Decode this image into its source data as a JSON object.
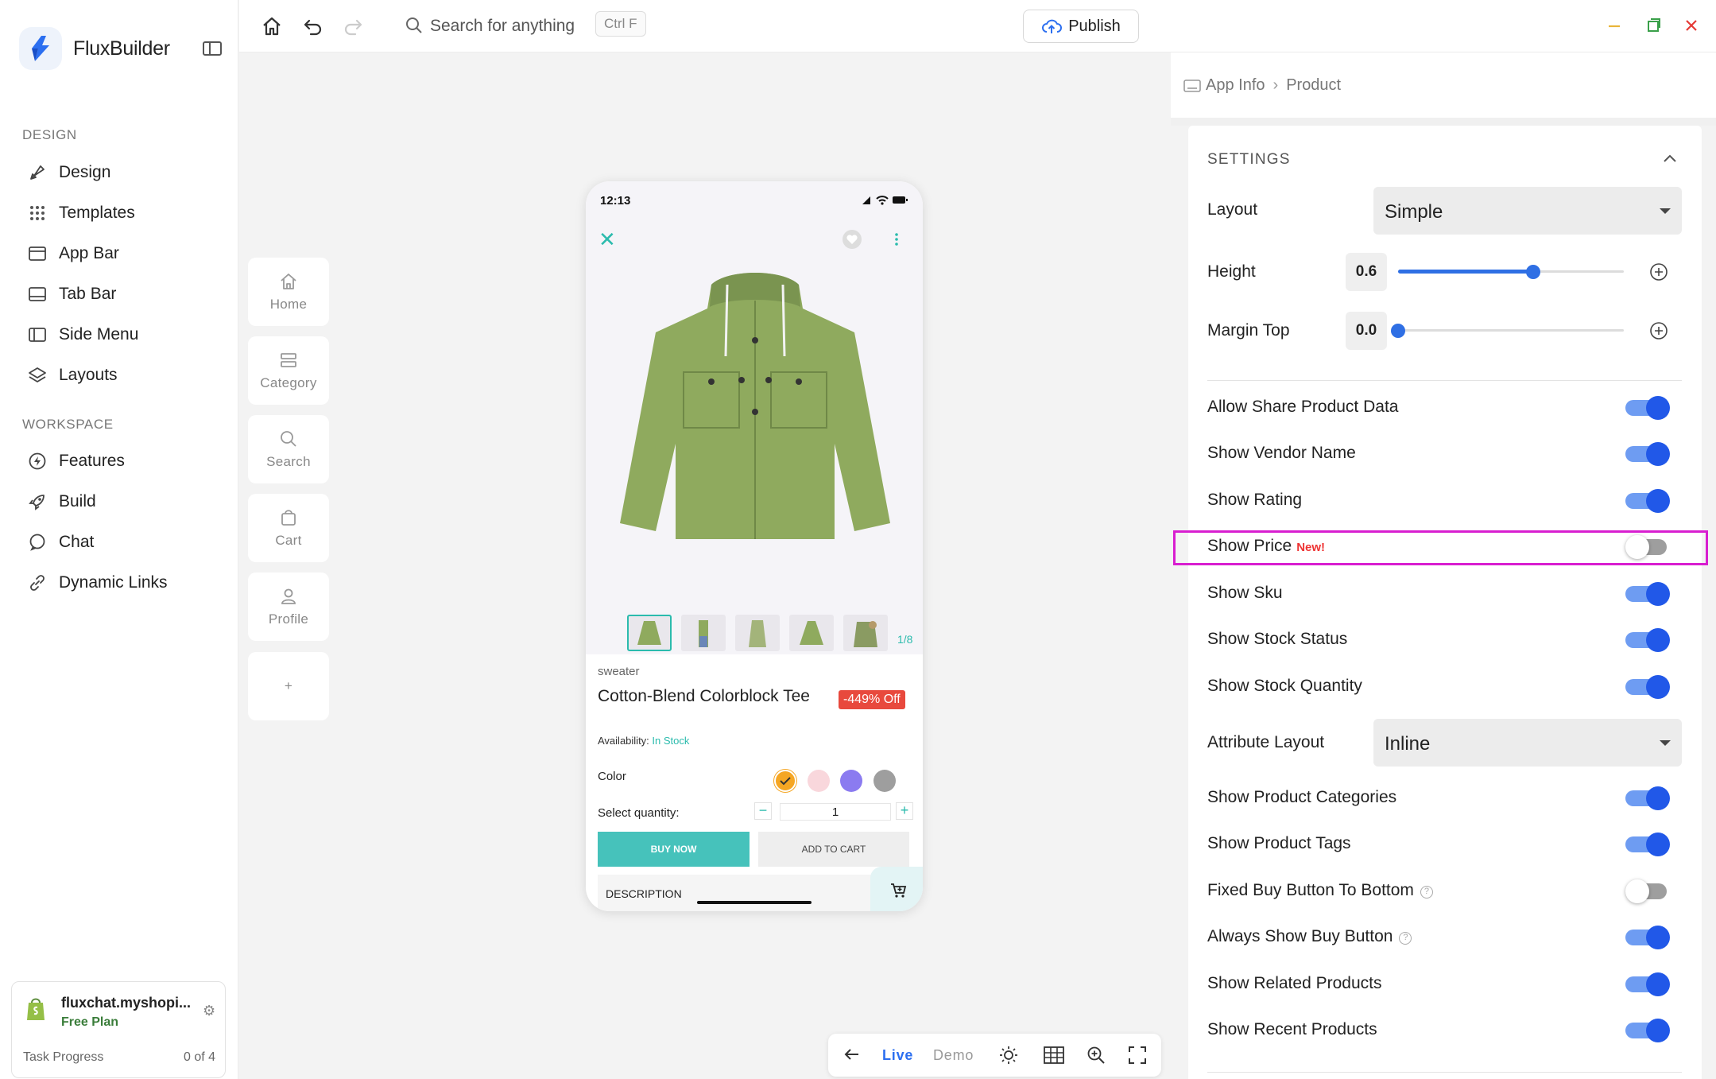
{
  "app": {
    "name": "FluxBuilder"
  },
  "sidebar": {
    "design_section": "DESIGN",
    "design_items": [
      {
        "label": "Design",
        "icon": "brush-icon"
      },
      {
        "label": "Templates",
        "icon": "grid-dots-icon"
      },
      {
        "label": "App Bar",
        "icon": "app-bar-icon"
      },
      {
        "label": "Tab Bar",
        "icon": "tab-bar-icon"
      },
      {
        "label": "Side Menu",
        "icon": "side-menu-icon"
      },
      {
        "label": "Layouts",
        "icon": "layers-icon"
      }
    ],
    "workspace_section": "WORKSPACE",
    "workspace_items": [
      {
        "label": "Features",
        "icon": "bolt-icon"
      },
      {
        "label": "Build",
        "icon": "rocket-icon"
      },
      {
        "label": "Chat",
        "icon": "chat-icon"
      },
      {
        "label": "Dynamic Links",
        "icon": "link-icon"
      }
    ],
    "store": {
      "name": "fluxchat.myshopi...",
      "plan": "Free Plan",
      "task_label": "Task Progress",
      "task_count": "0 of 4"
    }
  },
  "topbar": {
    "search_placeholder": "Search for anything",
    "shortcut": "Ctrl F",
    "publish_label": "Publish"
  },
  "screens": [
    {
      "label": "Home",
      "icon": "home-icon"
    },
    {
      "label": "Category",
      "icon": "category-icon"
    },
    {
      "label": "Search",
      "icon": "search-icon"
    },
    {
      "label": "Cart",
      "icon": "cart-icon"
    },
    {
      "label": "Profile",
      "icon": "profile-icon"
    }
  ],
  "phone": {
    "time": "12:13",
    "thumb_counter": "1/8",
    "category": "sweater",
    "product_name": "Cotton-Blend Colorblock Tee",
    "discount": "-449% Off",
    "availability_label": "Availability:",
    "availability_value": "In Stock",
    "color_label": "Color",
    "colors": [
      "#f5a623",
      "#f9d7dc",
      "#8b7bf0",
      "#9e9e9e"
    ],
    "quantity_label": "Select quantity:",
    "quantity": "1",
    "buy_now": "BUY NOW",
    "add_to_cart": "ADD TO CART",
    "description": "DESCRIPTION"
  },
  "bottom_bar": {
    "live": "Live",
    "demo": "Demo"
  },
  "panel": {
    "breadcrumb": [
      "App Info",
      "Product"
    ],
    "settings_title": "SETTINGS",
    "layout_label": "Layout",
    "layout_value": "Simple",
    "height_label": "Height",
    "height_value": "0.6",
    "height_fraction": 0.6,
    "margin_label": "Margin Top",
    "margin_value": "0.0",
    "margin_fraction": 0.0,
    "attribute_layout_label": "Attribute Layout",
    "attribute_layout_value": "Inline",
    "new_badge": "New!",
    "toggles_a": [
      {
        "label": "Allow Share Product Data",
        "on": true
      },
      {
        "label": "Show Vendor Name",
        "on": true
      },
      {
        "label": "Show Rating",
        "on": true
      },
      {
        "label": "Show Price",
        "on": false,
        "new": true
      },
      {
        "label": "Show Sku",
        "on": true
      },
      {
        "label": "Show Stock Status",
        "on": true
      },
      {
        "label": "Show Stock Quantity",
        "on": true
      }
    ],
    "toggles_b": [
      {
        "label": "Show Product Categories",
        "on": true
      },
      {
        "label": "Show Product Tags",
        "on": true
      },
      {
        "label": "Fixed Buy Button To Bottom",
        "on": false,
        "help": true
      },
      {
        "label": "Always Show Buy Button",
        "on": true,
        "help": true
      },
      {
        "label": "Show Related Products",
        "on": true
      },
      {
        "label": "Show Recent Products",
        "on": true
      }
    ]
  },
  "colors": {
    "accent": "#2158e8",
    "teal": "#2bbbad",
    "highlight": "#d81ed0"
  }
}
